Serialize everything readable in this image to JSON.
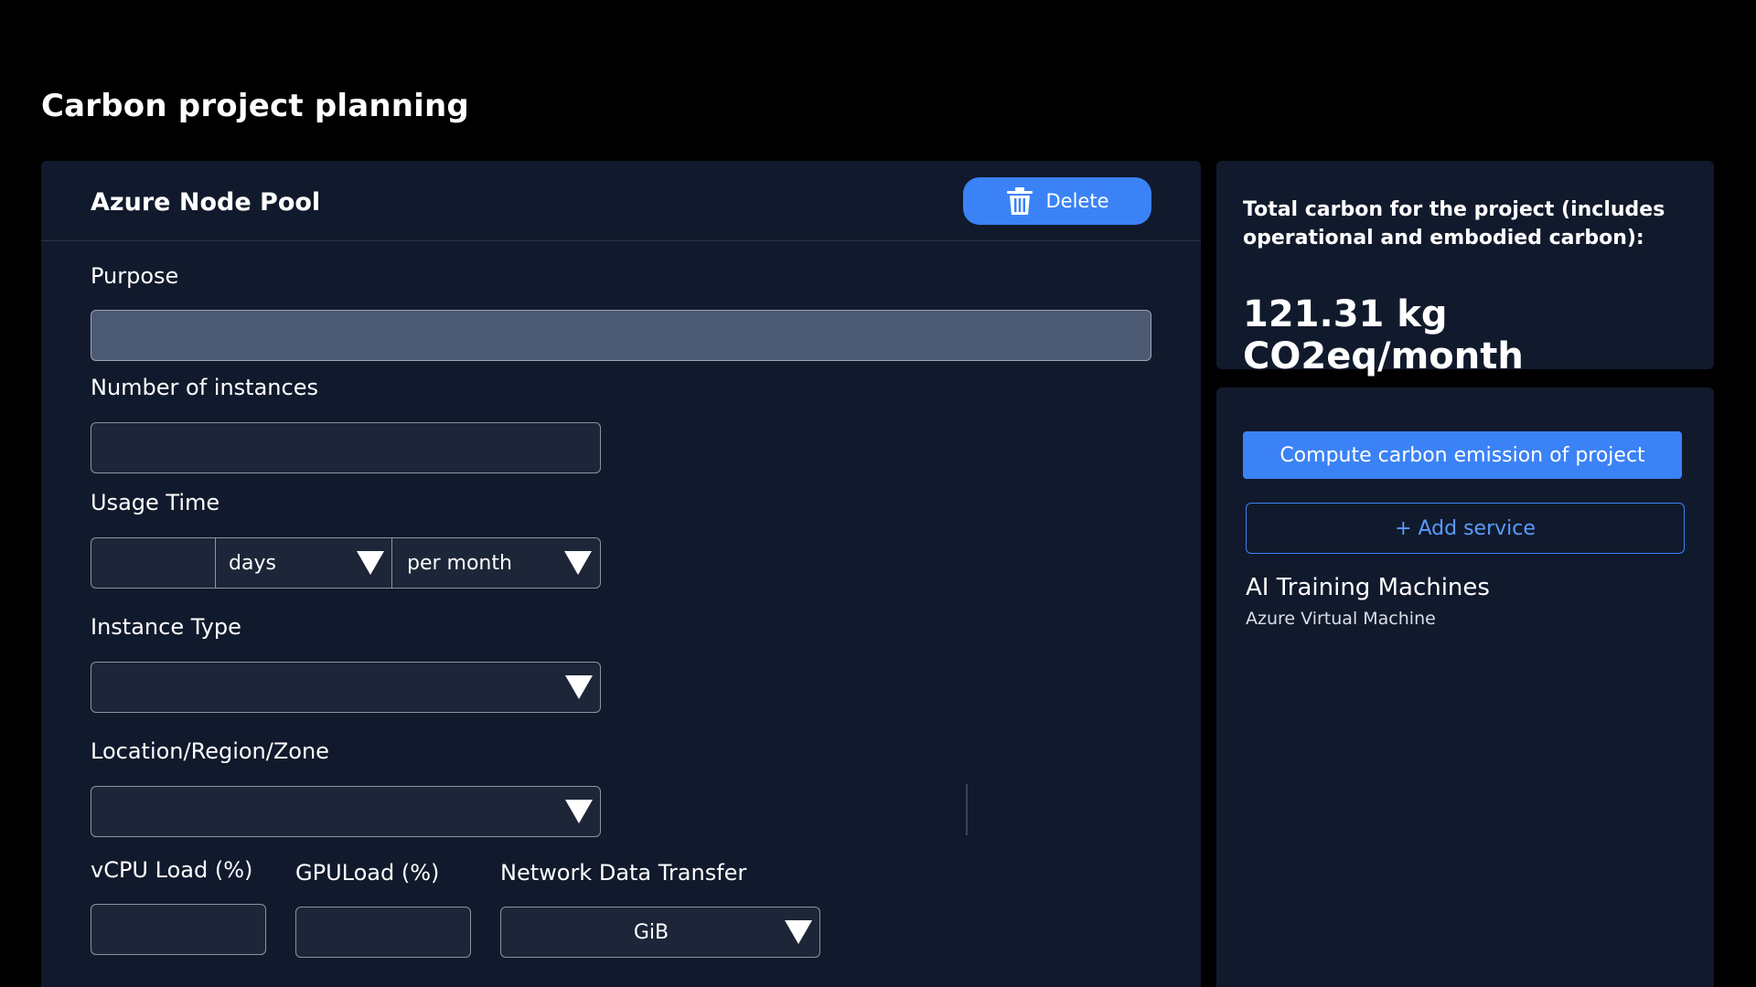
{
  "page": {
    "title": "Carbon project planning"
  },
  "form": {
    "title": "Azure Node Pool",
    "delete_label": "Delete",
    "purpose_label": "Purpose",
    "purpose_value": "",
    "instances_label": "Number of instances",
    "instances_value": "",
    "usage_label": "Usage Time",
    "usage_value": "",
    "usage_unit": "days",
    "usage_period": "per month",
    "instance_type_label": "Instance Type",
    "instance_type_value": "",
    "location_label": "Location/Region/Zone",
    "location_value": "",
    "vcpu_label": "vCPU Load (%)",
    "gpu_label": "GPULoad (%)",
    "network_label": "Network Data Transfer",
    "network_unit": "GiB"
  },
  "summary": {
    "label": "Total carbon for the project (includes operational and embodied carbon):",
    "value": "121.31 kg CO2eq/month"
  },
  "services": {
    "compute_label": "Compute carbon emission of project",
    "add_label": "+ Add service",
    "items": [
      {
        "name": "AI Training Machines",
        "type": "Azure Virtual Machine"
      }
    ]
  },
  "colors": {
    "accent": "#3b82f6",
    "panel": "#111a2c",
    "background": "#000000"
  },
  "icons": {
    "delete": "trash-icon",
    "dropdown": "triangle-down-icon"
  }
}
